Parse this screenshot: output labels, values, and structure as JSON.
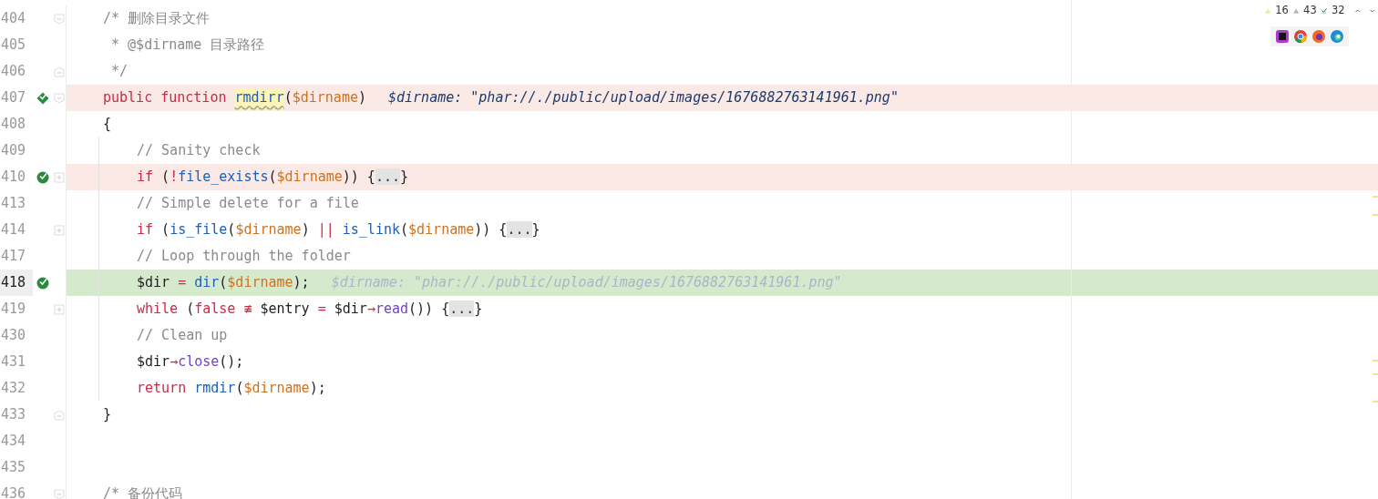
{
  "editor": {
    "lines": [
      {
        "number": "404",
        "current": false,
        "fold": {
          "kind": "open"
        },
        "tokens": [
          {
            "kind": "comment",
            "text": "/* 删除目录文件"
          }
        ]
      },
      {
        "number": "405",
        "current": false,
        "tokens": [
          {
            "kind": "comment",
            "text": " * @$dirname 目录路径"
          }
        ]
      },
      {
        "number": "406",
        "current": false,
        "fold": {
          "kind": "close"
        },
        "tokens": [
          {
            "kind": "comment",
            "text": " */"
          }
        ]
      },
      {
        "number": "407",
        "current": false,
        "breakpoint": {
          "kind": "method"
        },
        "fold": {
          "kind": "open"
        },
        "tokens": [
          {
            "kind": "keyword",
            "text": "public function "
          },
          {
            "kind": "warn",
            "text": "rmdirr"
          },
          {
            "kind": "plain",
            "text": "("
          },
          {
            "kind": "var",
            "text": "$dirname"
          },
          {
            "kind": "plain",
            "text": ")"
          }
        ],
        "hint": {
          "kind": "value",
          "text": "$dirname: \"phar://./public/upload/images/1676882763141961.png\""
        }
      },
      {
        "number": "408",
        "current": false,
        "tokens": [
          {
            "kind": "plain",
            "text": "{"
          }
        ],
        "children": [
          {
            "number": "409",
            "current": false,
            "tokens": [
              {
                "kind": "comment",
                "text": "// Sanity check"
              }
            ]
          },
          {
            "number": "410",
            "current": false,
            "breakpoint": {
              "kind": "line"
            },
            "fold": {
              "kind": "collapsed"
            },
            "tokens": [
              {
                "kind": "keyword",
                "text": "if"
              },
              {
                "kind": "plain",
                "text": " ("
              },
              {
                "kind": "keyword",
                "text": "!"
              },
              {
                "kind": "func",
                "text": "file_exists"
              },
              {
                "kind": "plain",
                "text": "("
              },
              {
                "kind": "var",
                "text": "$dirname"
              },
              {
                "kind": "plain",
                "text": ")) {"
              },
              {
                "kind": "folded",
                "text": "..."
              },
              {
                "kind": "plain",
                "text": "}"
              }
            ]
          },
          {
            "number": "413",
            "current": false,
            "tokens": [
              {
                "kind": "comment",
                "text": "// Simple delete for a file"
              }
            ]
          },
          {
            "number": "414",
            "current": false,
            "fold": {
              "kind": "collapsed"
            },
            "tokens": [
              {
                "kind": "keyword",
                "text": "if"
              },
              {
                "kind": "plain",
                "text": " ("
              },
              {
                "kind": "func",
                "text": "is_file"
              },
              {
                "kind": "plain",
                "text": "("
              },
              {
                "kind": "var",
                "text": "$dirname"
              },
              {
                "kind": "plain",
                "text": ") "
              },
              {
                "kind": "keyword",
                "text": "|| "
              },
              {
                "kind": "func",
                "text": "is_link"
              },
              {
                "kind": "plain",
                "text": "("
              },
              {
                "kind": "var",
                "text": "$dirname"
              },
              {
                "kind": "plain",
                "text": ")) {"
              },
              {
                "kind": "folded",
                "text": "..."
              },
              {
                "kind": "plain",
                "text": "}"
              }
            ]
          },
          {
            "number": "417",
            "current": false,
            "tokens": [
              {
                "kind": "comment",
                "text": "// Loop through the folder"
              }
            ]
          },
          {
            "number": "418",
            "current": true,
            "breakpoint": {
              "kind": "line"
            },
            "tokens": [
              {
                "kind": "plain",
                "text": "$dir "
              },
              {
                "kind": "keyword",
                "text": "= "
              },
              {
                "kind": "func",
                "text": "dir"
              },
              {
                "kind": "plain",
                "text": "("
              },
              {
                "kind": "var",
                "text": "$dirname"
              },
              {
                "kind": "plain",
                "text": ");"
              }
            ],
            "hint": {
              "kind": "dim",
              "text": "$dirname: \"phar://./public/upload/images/1676882763141961.png\""
            }
          },
          {
            "number": "419",
            "current": false,
            "fold": {
              "kind": "collapsed"
            },
            "tokens": [
              {
                "kind": "keyword",
                "text": "while"
              },
              {
                "kind": "plain",
                "text": " ("
              },
              {
                "kind": "keyword",
                "text": "false ≢"
              },
              {
                "kind": "plain",
                "text": " $entry "
              },
              {
                "kind": "keyword",
                "text": "="
              },
              {
                "kind": "plain",
                "text": " $dir"
              },
              {
                "kind": "keyword",
                "text": "→"
              },
              {
                "kind": "method",
                "text": "read"
              },
              {
                "kind": "plain",
                "text": "()) {"
              },
              {
                "kind": "folded",
                "text": "..."
              },
              {
                "kind": "plain",
                "text": "}"
              }
            ]
          },
          {
            "number": "430",
            "current": false,
            "tokens": [
              {
                "kind": "comment",
                "text": "// Clean up"
              }
            ]
          },
          {
            "number": "431",
            "current": false,
            "tokens": [
              {
                "kind": "plain",
                "text": "$dir"
              },
              {
                "kind": "keyword",
                "text": "→"
              },
              {
                "kind": "method",
                "text": "close"
              },
              {
                "kind": "plain",
                "text": "();"
              }
            ]
          },
          {
            "number": "432",
            "current": false,
            "tokens": [
              {
                "kind": "keyword",
                "text": "return "
              },
              {
                "kind": "func",
                "text": "rmdir"
              },
              {
                "kind": "plain",
                "text": "("
              },
              {
                "kind": "var",
                "text": "$dirname"
              },
              {
                "kind": "plain",
                "text": ");"
              }
            ]
          }
        ]
      },
      {
        "number": "433",
        "current": false,
        "fold": {
          "kind": "close"
        },
        "tokens": [
          {
            "kind": "plain",
            "text": "}"
          }
        ]
      },
      {
        "number": "434",
        "current": false
      },
      {
        "number": "435",
        "current": false
      },
      {
        "number": "436",
        "current": false,
        "fold": {
          "kind": "open"
        },
        "tokens": [
          {
            "kind": "comment",
            "text": "/* 备份代码"
          }
        ]
      }
    ]
  },
  "inspections": [
    {
      "kind": "warning",
      "count": "16"
    },
    {
      "kind": "weak",
      "count": "43"
    },
    {
      "kind": "typo",
      "count": "32"
    }
  ],
  "browsers": [
    {
      "kind": "ide"
    },
    {
      "kind": "chrome"
    },
    {
      "kind": "firefox"
    },
    {
      "kind": "edge"
    }
  ]
}
